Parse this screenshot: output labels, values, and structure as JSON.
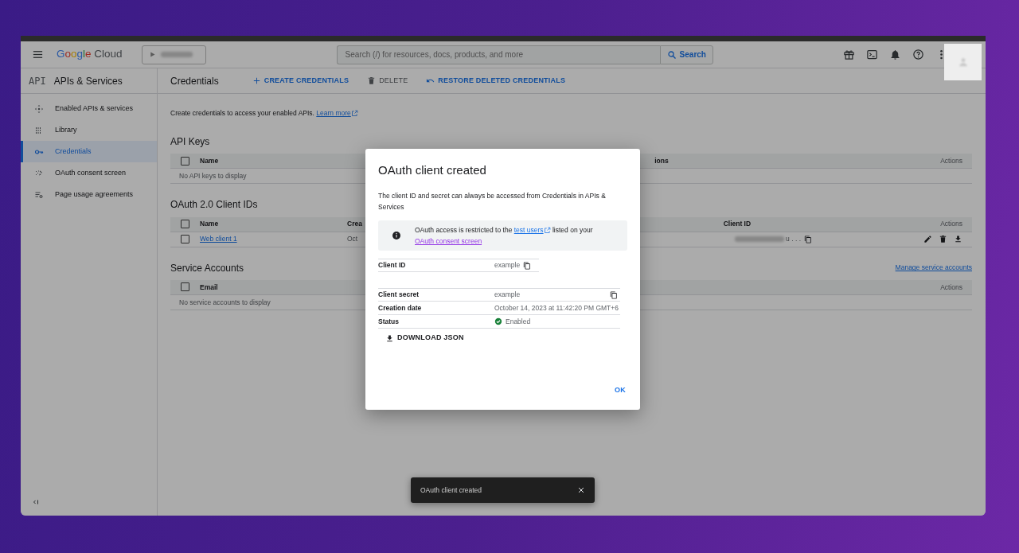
{
  "header": {
    "brand": "Google",
    "product": "Cloud",
    "search": {
      "placeholder": "Search (/) for resources, docs, products, and more",
      "button": "Search"
    }
  },
  "sidebar": {
    "logo": "API",
    "title": "APIs & Services",
    "items": [
      {
        "label": "Enabled APIs & services",
        "selected": false
      },
      {
        "label": "Library",
        "selected": false
      },
      {
        "label": "Credentials",
        "selected": true
      },
      {
        "label": "OAuth consent screen",
        "selected": false
      },
      {
        "label": "Page usage agreements",
        "selected": false
      }
    ]
  },
  "toolbar": {
    "title": "Credentials",
    "actions": [
      {
        "label": "CREATE CREDENTIALS",
        "disabled": false
      },
      {
        "label": "DELETE",
        "disabled": true
      },
      {
        "label": "RESTORE DELETED CREDENTIALS",
        "disabled": false
      }
    ]
  },
  "intro": {
    "text": "Create credentials to access your enabled APIs.",
    "link": "Learn more"
  },
  "api_keys": {
    "title": "API Keys",
    "select_all_checked": false,
    "columns": [
      "Name",
      "ions",
      "Actions"
    ],
    "empty": "No API keys to display"
  },
  "oauth_clients": {
    "title": "OAuth 2.0 Client IDs",
    "select_all_checked": false,
    "columns": [
      "Name",
      "Crea",
      "Client ID",
      "Actions"
    ],
    "rows": [
      {
        "name": "Web client 1",
        "column_2": "Oct",
        "client_id": "u . . .",
        "checked": false
      }
    ]
  },
  "service_accounts": {
    "title": "Service Accounts",
    "link": "Manage service accounts",
    "select_all_checked": false,
    "columns": [
      "Email",
      "Actions"
    ],
    "empty": "No service accounts to display"
  },
  "dialog": {
    "title": "OAuth client created",
    "text": "The client ID and secret can always be accessed from Credentials in APIs & Services",
    "notice": {
      "before": "OAuth access is restricted to the",
      "link": "test users",
      "after": "listed on your",
      "link2": "OAuth consent screen"
    },
    "client_id": {
      "label": "Client ID",
      "value": "example"
    },
    "details": [
      {
        "label": "Client secret",
        "value": "example",
        "kind": "copy"
      },
      {
        "label": "Creation date",
        "value": "October 14, 2023 at 11:42:20 PM GMT+6",
        "kind": "text"
      },
      {
        "label": "Status",
        "value": "Enabled",
        "kind": "status"
      }
    ],
    "download": "DOWNLOAD JSON",
    "ok": "OK"
  },
  "toast": {
    "message": "OAuth client created"
  }
}
